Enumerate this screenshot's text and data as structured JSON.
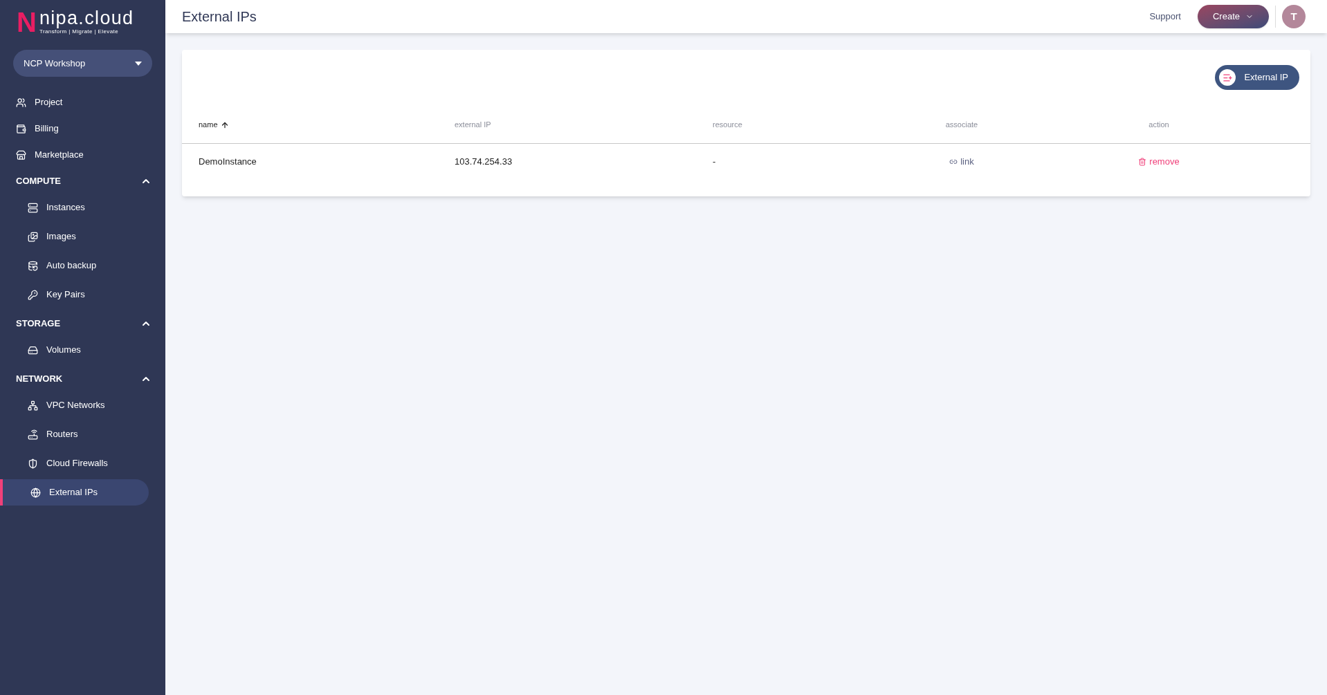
{
  "logo": {
    "mark": "N",
    "name": "nipa.cloud",
    "tagline": "Transform | Migrate | Elevate"
  },
  "project_selector": {
    "value": "NCP Workshop"
  },
  "sidebar": {
    "items": [
      {
        "kind": "link",
        "label": "Project",
        "selected": false
      },
      {
        "kind": "link",
        "label": "Billing",
        "selected": false
      },
      {
        "kind": "link",
        "label": "Marketplace",
        "selected": false
      },
      {
        "kind": "section",
        "label": "COMPUTE",
        "expanded": true,
        "children": [
          {
            "label": "Instances",
            "selected": false
          },
          {
            "label": "Images",
            "selected": false
          },
          {
            "label": "Auto backup",
            "selected": false
          },
          {
            "label": "Key Pairs",
            "selected": false
          }
        ]
      },
      {
        "kind": "section",
        "label": "STORAGE",
        "expanded": true,
        "children": [
          {
            "label": "Volumes",
            "selected": false
          }
        ]
      },
      {
        "kind": "section",
        "label": "NETWORK",
        "expanded": true,
        "children": [
          {
            "label": "VPC Networks",
            "selected": false
          },
          {
            "label": "Routers",
            "selected": false
          },
          {
            "label": "Cloud Firewalls",
            "selected": false
          },
          {
            "label": "External IPs",
            "selected": true
          }
        ]
      }
    ]
  },
  "header": {
    "title": "External IPs",
    "support": "Support",
    "create": "Create",
    "avatar": "T"
  },
  "card": {
    "add_button": "External IP",
    "table": {
      "columns": [
        {
          "label": "name",
          "sorted": true
        },
        {
          "label": "external IP",
          "sorted": false
        },
        {
          "label": "resource",
          "sorted": false
        },
        {
          "label": "associate",
          "sorted": false
        },
        {
          "label": "action",
          "sorted": false
        }
      ],
      "rows": [
        {
          "name": "DemoInstance",
          "external_ip": "103.74.254.33",
          "resource": "-",
          "associate": "link",
          "action": "remove"
        }
      ]
    }
  }
}
